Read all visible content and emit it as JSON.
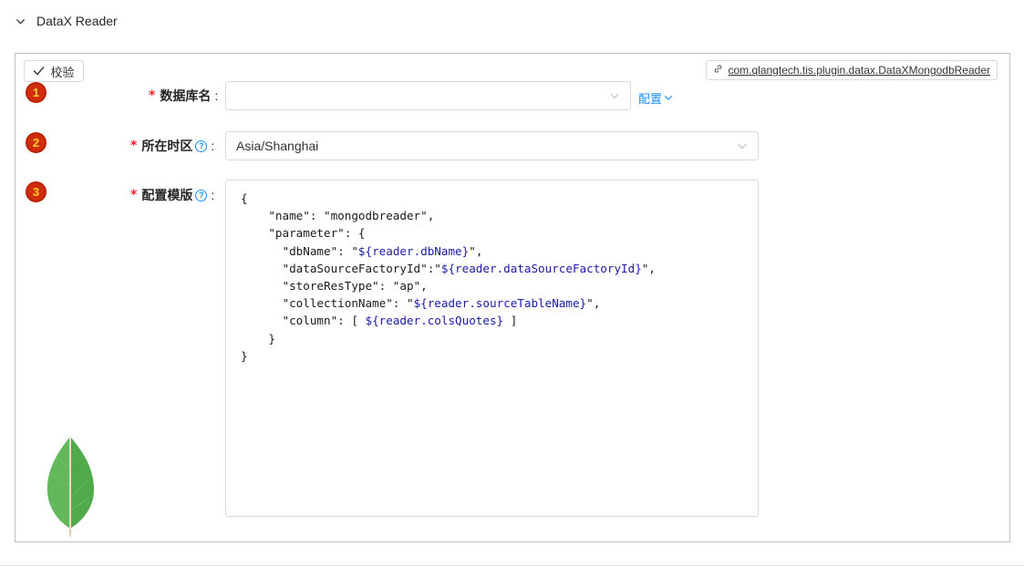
{
  "section": {
    "title": "DataX Reader"
  },
  "toolbar": {
    "verify_label": "校验"
  },
  "plugin": {
    "link_text": "com.qlangtech.tis.plugin.datax.DataXMongodbReader"
  },
  "fields": {
    "dbname": {
      "step": "1",
      "label": "数据库名",
      "value": "",
      "config_label": "配置"
    },
    "timezone": {
      "step": "2",
      "label": "所在时区",
      "value": "Asia/Shanghai"
    },
    "template": {
      "step": "3",
      "label": "配置模版",
      "lines": [
        [
          "{",
          ""
        ],
        [
          "    \"name\": \"mongodbreader\",",
          ""
        ],
        [
          "    \"parameter\": {",
          ""
        ],
        [
          "      \"dbName\": \"",
          "${reader.dbName}",
          "\","
        ],
        [
          "      \"dataSourceFactoryId\":\"",
          "${reader.dataSourceFactoryId}",
          "\","
        ],
        [
          "      \"storeResType\": \"ap\",",
          ""
        ],
        [
          "      \"collectionName\": \"",
          "${reader.sourceTableName}",
          "\","
        ],
        [
          "      \"column\": [ ",
          "${reader.colsQuotes}",
          " ]"
        ],
        [
          "    }",
          ""
        ],
        [
          "}",
          ""
        ]
      ]
    }
  },
  "common": {
    "required_mark": "*",
    "colon": ":",
    "help_mark": "?"
  },
  "colors": {
    "accent": "#1890ff",
    "required": "#f5222d",
    "badge": "#d22d0b",
    "leaf": "#4caf50"
  },
  "icons": {
    "chevron": "chevron-down-icon",
    "check": "check-icon",
    "link": "link-icon",
    "help": "question-circle-icon",
    "leaf": "mongodb-leaf-icon"
  }
}
